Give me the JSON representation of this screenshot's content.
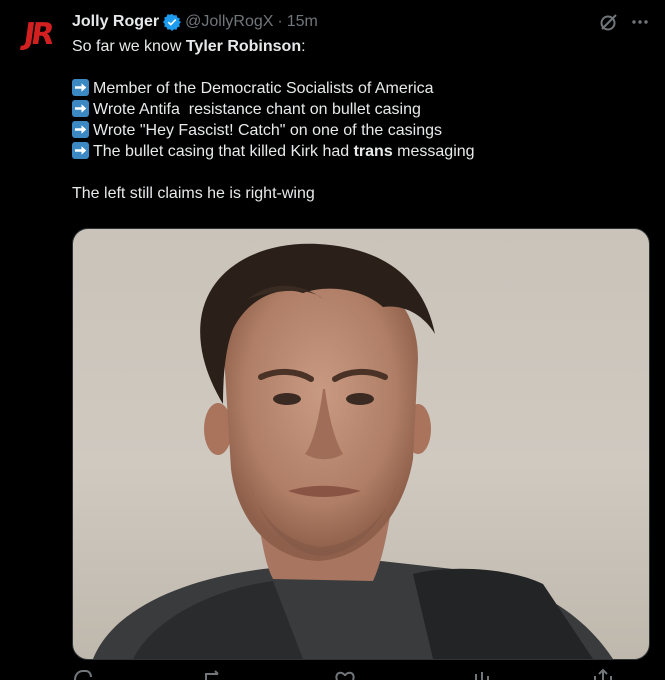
{
  "author": {
    "avatar_text": "JR",
    "name": "Jolly Roger",
    "handle": "@JollyRogX",
    "separator": "·",
    "time": "15m"
  },
  "tweet": {
    "intro_plain": "So far we know ",
    "intro_bold": "Tyler Robinson",
    "intro_end": ":",
    "bullets": [
      "Member of the Democratic Socialists of America",
      "Wrote Antifa  resistance chant on bullet casing",
      "Wrote \"Hey Fascist! Catch\" on one of the casings"
    ],
    "bullet4_plain": "The bullet casing that killed Kirk had ",
    "bullet4_bold": "trans",
    "bullet4_end": " messaging",
    "closing": "The left still claims he is right-wing"
  },
  "colors": {
    "background": "#000000",
    "text": "#e7e9ea",
    "muted": "#71767b",
    "verified": "#1d9bf0",
    "arrow_emoji": "#3b88c3",
    "avatar": "#d21f1f"
  },
  "icons": {
    "verified": "verified-badge-icon",
    "grok": "grok-icon",
    "more": "more-icon",
    "bullet": "right-arrow-emoji-icon"
  }
}
